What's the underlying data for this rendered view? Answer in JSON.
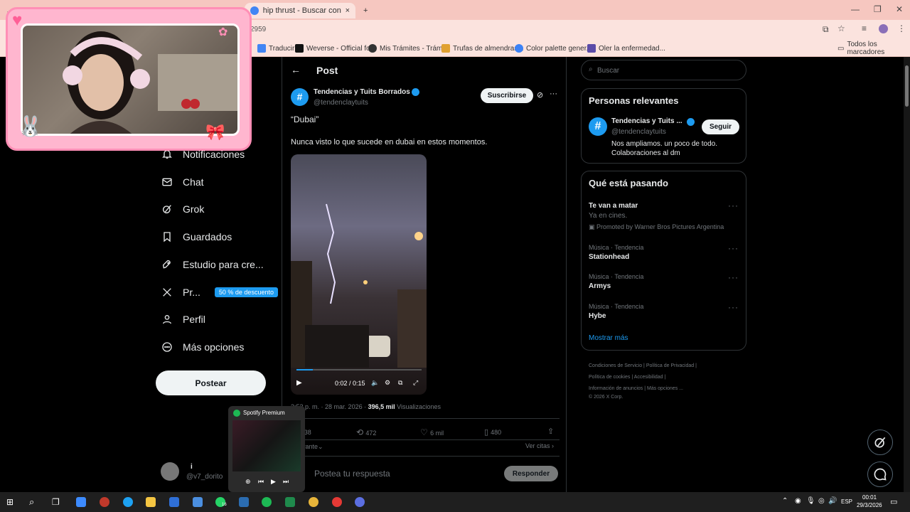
{
  "browser": {
    "tabs": [
      {
        "label": "hip thrust - Buscar con Google",
        "close": "×"
      }
    ],
    "new_tab": "+",
    "address": "2959",
    "window_controls": [
      "—",
      "❐",
      "✕"
    ],
    "bookmarks": [
      "Traducir",
      "Weverse - Official fo...",
      "Mis Trámites - Trámi...",
      "Trufas de almendras...",
      "Color palette gener...",
      "Oler la enfermedad..."
    ],
    "bookmarks_folder": "Todos los marcadores"
  },
  "nav": {
    "items": [
      "Notificaciones",
      "Chat",
      "Grok",
      "Guardados",
      "Estudio para cre...",
      "Pr...",
      "Perfil",
      "Más opciones"
    ],
    "premium_badge": "50 % de descuento",
    "post_button": "Postear",
    "account_name": "i",
    "account_handle": "@v7_dorito"
  },
  "post": {
    "header": "Post",
    "author_name": "Tendencias y Tuits Borrados",
    "author_handle": "@tendenclaytuits",
    "subscribe": "Suscribirse",
    "text_quote": "“Dubai”",
    "text_body": "Nunca visto lo que sucede en dubai en estos momentos.",
    "video_time": "0:02 / 0:15",
    "meta_time": "· 28 mar. 2026 ·",
    "meta_time_prefix": "3:53 p. m.",
    "views_count": "396,5 mil",
    "views_label": "Visualizaciones",
    "reply_count": "138",
    "repost_count": "472",
    "like_count": "6 mil",
    "bookmark_count": "480",
    "sort_label": "vante",
    "ver_citas": "Ver citas",
    "reply_placeholder": "Postea tu respuesta",
    "reply_button": "Responder",
    "video_progress": 0.13
  },
  "sidebar": {
    "search_placeholder": "Buscar",
    "relevant_title": "Personas relevantes",
    "relevant_name": "Tendencias y Tuits ...",
    "relevant_handle": "@tendenclaytuits",
    "follow": "Seguir",
    "relevant_bio": "Nos ampliamos. un poco de todo. Colaboraciones al dm",
    "trending_title": "Qué está pasando",
    "promo_name": "Te van a matar",
    "promo_sub": "Ya en cines.",
    "promo_by": "Promoted by Warner Bros Pictures Argentina",
    "trends": [
      {
        "category": "Música · Tendencia",
        "name": "Stationhead"
      },
      {
        "category": "Música · Tendencia",
        "name": "Armys"
      },
      {
        "category": "Música · Tendencia",
        "name": "Hybe"
      }
    ],
    "show_more": "Mostrar más",
    "footer": [
      "Condiciones de Servicio",
      "Política de Privacidad",
      "Política de cookies",
      "Accesibilidad",
      "Información de anuncios",
      "Más opciones ...",
      "© 2026 X Corp."
    ]
  },
  "spotify": {
    "title": "Spotify Premium"
  },
  "taskbar": {
    "lang": "ESP",
    "time": "00:01",
    "date": "29/3/2026",
    "badge": "16"
  },
  "colors": {
    "accent": "#1d9bf0",
    "spotify": "#1db954",
    "chrome": "#f6c7c0"
  }
}
